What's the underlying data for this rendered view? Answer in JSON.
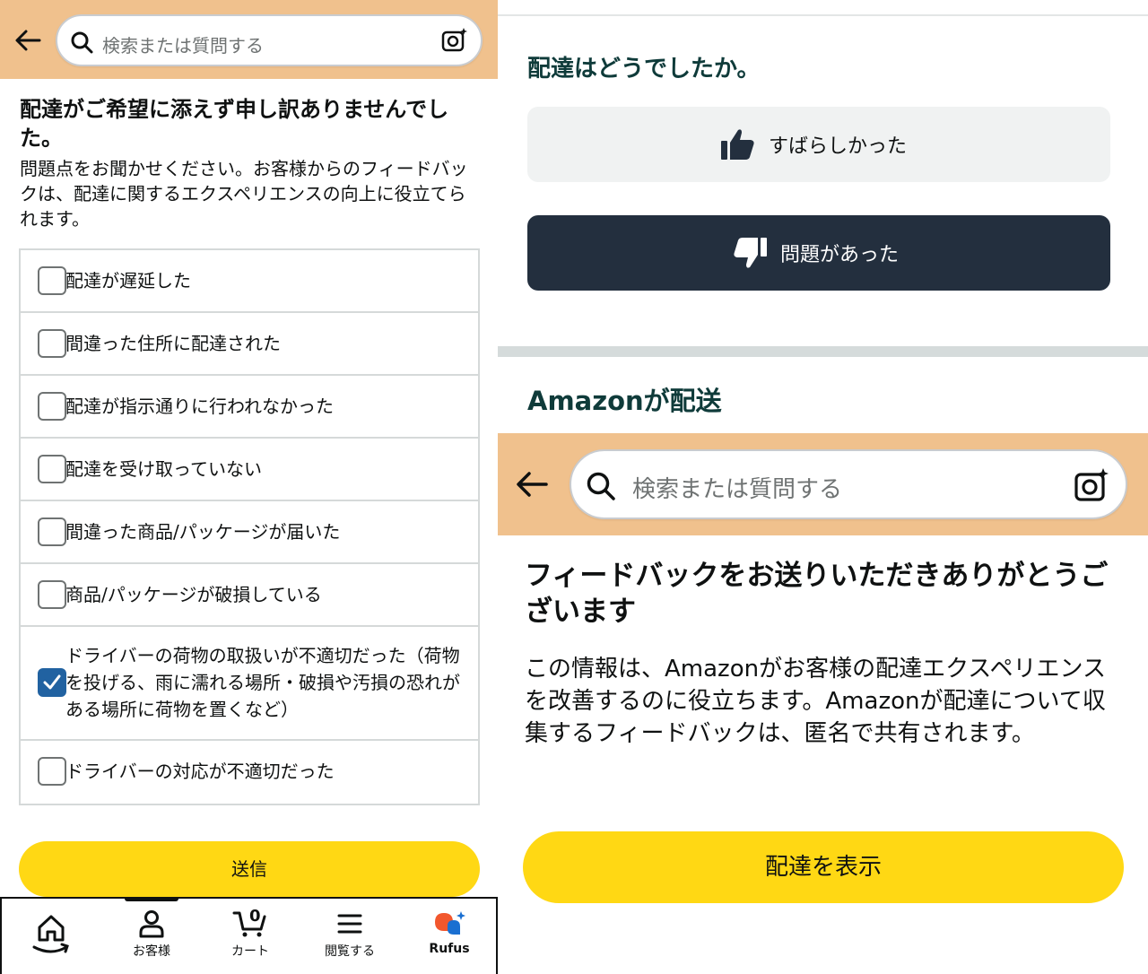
{
  "left": {
    "search": {
      "placeholder": "検索または質問する"
    },
    "title": "配達がご希望に添えず申し訳ありませんでした。",
    "description": "問題点をお聞かせください。お客様からのフィードバックは、配達に関するエクスペリエンスの向上に役立てられます。",
    "options": [
      {
        "label": "配達が遅延した",
        "checked": false
      },
      {
        "label": "間違った住所に配達された",
        "checked": false
      },
      {
        "label": "配達が指示通りに行われなかった",
        "checked": false
      },
      {
        "label": "配達を受け取っていない",
        "checked": false
      },
      {
        "label": "間違った商品/パッケージが届いた",
        "checked": false
      },
      {
        "label": "商品/パッケージが破損している",
        "checked": false
      },
      {
        "label": "ドライバーの荷物の取扱いが不適切だった（荷物を投げる、雨に濡れる場所・破損や汚損の恐れがある場所に荷物を置くなど）",
        "checked": true
      },
      {
        "label": "ドライバーの対応が不適切だった",
        "checked": false
      }
    ],
    "submit_label": "送信",
    "nav": {
      "cart_count": "0",
      "items": [
        {
          "label": "",
          "icon": "home-icon"
        },
        {
          "label": "お客様",
          "icon": "user-icon"
        },
        {
          "label": "カート",
          "icon": "cart-icon"
        },
        {
          "label": "閲覧する",
          "icon": "menu-icon"
        },
        {
          "label": "Rufus",
          "icon": "rufus-icon"
        }
      ]
    }
  },
  "right": {
    "question": "配達はどうでしたか。",
    "good_label": "すばらしかった",
    "bad_label": "問題があった",
    "shipper": "Amazonが配送",
    "search": {
      "placeholder": "検索または質問する"
    },
    "thanks_title": "フィードバックをお送りいただきありがとうございます",
    "info_text": "この情報は、Amazonがお客様の配達エクスペリエンスを改善するのに役立ちます。Amazonが配達について収集するフィードバックは、匿名で共有されます。",
    "view_label": "配達を表示"
  },
  "colors": {
    "header_bg": "#f0c18d",
    "primary_button": "#ffd814",
    "dark_button": "#232f3e",
    "checkbox_checked": "#2162a1",
    "heading_teal": "#0f3b3a"
  }
}
